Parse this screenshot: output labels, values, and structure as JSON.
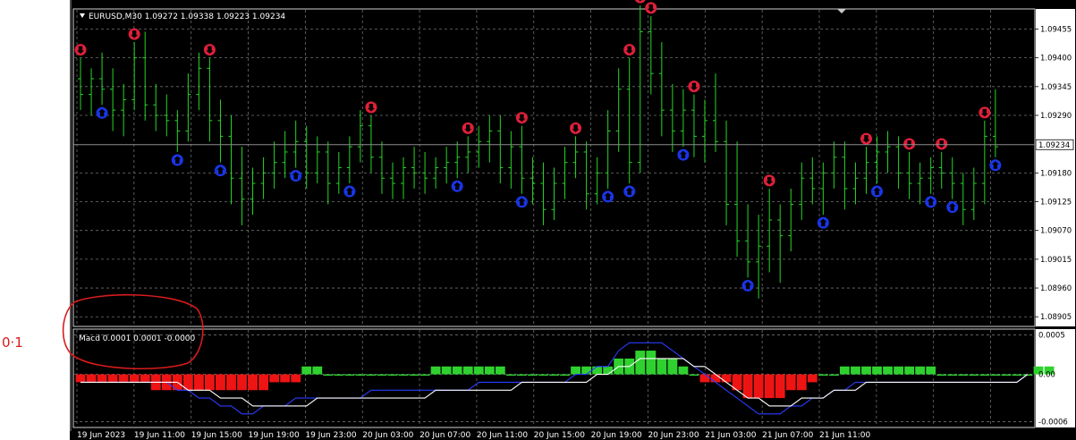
{
  "symbol_header": "EURUSD,M30  1.09272 1.09338 1.09223 1.09234",
  "current_price": "1.09234",
  "annotation_text": "0·1",
  "macd_label": "Macd 0.0001 0.0001 -0.0000",
  "colors": {
    "background": "#000000",
    "grid": "#6f6f6f",
    "bars": "#26d626",
    "sell_arrow": "#e0203a",
    "buy_arrow": "#1a35e8",
    "histogram_up": "#2fd12f",
    "histogram_down": "#ee1414",
    "macd_line": "#ffffff",
    "signal_line": "#2a3cff",
    "annotation": "#d81b1b"
  },
  "icons": {
    "sell": "down-arrow-circle-icon",
    "buy": "up-arrow-circle-icon",
    "menu": "triangle-down-icon"
  },
  "chart_data": [
    {
      "type": "ohlc-bars",
      "title": "EURUSD,M30",
      "y_ticks": [
        "1.09455",
        "1.09400",
        "1.09345",
        "1.09290",
        "1.09180",
        "1.09125",
        "1.09070",
        "1.09015",
        "1.08960",
        "1.08905"
      ],
      "ylim": [
        1.0889,
        1.0949
      ],
      "x_ticks": [
        "19 Jun 2023",
        "19 Jun 11:00",
        "19 Jun 15:00",
        "19 Jun 19:00",
        "19 Jun 23:00",
        "20 Jun 03:00",
        "20 Jun 07:00",
        "20 Jun 11:00",
        "20 Jun 15:00",
        "20 Jun 19:00",
        "20 Jun 23:00",
        "21 Jun 03:00",
        "21 Jun 07:00",
        "21 Jun 11:00"
      ],
      "last": {
        "open": 1.09272,
        "high": 1.09338,
        "low": 1.09223,
        "close": 1.09234
      },
      "bars": [
        [
          1.0936,
          1.094,
          1.093,
          1.0933
        ],
        [
          1.0933,
          1.0938,
          1.0929,
          1.0936
        ],
        [
          1.0936,
          1.0941,
          1.0931,
          1.0934
        ],
        [
          1.0934,
          1.0938,
          1.0926,
          1.093
        ],
        [
          1.093,
          1.0935,
          1.0925,
          1.0932
        ],
        [
          1.0932,
          1.0943,
          1.093,
          1.094
        ],
        [
          1.094,
          1.0945,
          1.0928,
          1.0931
        ],
        [
          1.0931,
          1.0935,
          1.0926,
          1.0929
        ],
        [
          1.0929,
          1.0933,
          1.0925,
          1.0928
        ],
        [
          1.0928,
          1.093,
          1.0922,
          1.0926
        ],
        [
          1.0926,
          1.0937,
          1.0924,
          1.0933
        ],
        [
          1.0933,
          1.0941,
          1.093,
          1.0938
        ],
        [
          1.0938,
          1.094,
          1.0924,
          1.0928
        ],
        [
          1.0928,
          1.0932,
          1.092,
          1.0925
        ],
        [
          1.0925,
          1.0929,
          1.0912,
          1.0917
        ],
        [
          1.0917,
          1.0923,
          1.0908,
          1.0913
        ],
        [
          1.0913,
          1.0919,
          1.091,
          1.0916
        ],
        [
          1.0916,
          1.0921,
          1.0913,
          1.0918
        ],
        [
          1.0918,
          1.0924,
          1.0915,
          1.092
        ],
        [
          1.092,
          1.0926,
          1.0917,
          1.0922
        ],
        [
          1.0922,
          1.0928,
          1.0919,
          1.0924
        ],
        [
          1.0924,
          1.0927,
          1.0915,
          1.0918
        ],
        [
          1.0918,
          1.0925,
          1.0916,
          1.0922
        ],
        [
          1.0922,
          1.0924,
          1.0912,
          1.0916
        ],
        [
          1.0916,
          1.0922,
          1.0914,
          1.0919
        ],
        [
          1.0919,
          1.0925,
          1.0916,
          1.0923
        ],
        [
          1.0923,
          1.093,
          1.092,
          1.0927
        ],
        [
          1.0927,
          1.0929,
          1.0918,
          1.0921
        ],
        [
          1.0921,
          1.0924,
          1.0914,
          1.0917
        ],
        [
          1.0917,
          1.092,
          1.0913,
          1.0916
        ],
        [
          1.0916,
          1.0921,
          1.0913,
          1.0919
        ],
        [
          1.0919,
          1.0923,
          1.0915,
          1.0918
        ],
        [
          1.0918,
          1.0922,
          1.0914,
          1.0917
        ],
        [
          1.0917,
          1.0921,
          1.0915,
          1.0919
        ],
        [
          1.0919,
          1.0923,
          1.0916,
          1.092
        ],
        [
          1.092,
          1.0924,
          1.0917,
          1.0921
        ],
        [
          1.0921,
          1.0925,
          1.0918,
          1.0922
        ],
        [
          1.0922,
          1.0927,
          1.0919,
          1.0924
        ],
        [
          1.0924,
          1.0929,
          1.092,
          1.0926
        ],
        [
          1.0926,
          1.0929,
          1.0916,
          1.0919
        ],
        [
          1.0919,
          1.0926,
          1.0915,
          1.0923
        ],
        [
          1.0923,
          1.0927,
          1.0914,
          1.0917
        ],
        [
          1.0917,
          1.0921,
          1.0912,
          1.0916
        ],
        [
          1.0916,
          1.092,
          1.0908,
          1.0911
        ],
        [
          1.0911,
          1.0919,
          1.0909,
          1.0916
        ],
        [
          1.0916,
          1.0923,
          1.0913,
          1.092
        ],
        [
          1.092,
          1.0925,
          1.0917,
          1.0922
        ],
        [
          1.0922,
          1.0924,
          1.0911,
          1.0914
        ],
        [
          1.0914,
          1.0921,
          1.0912,
          1.0918
        ],
        [
          1.0918,
          1.093,
          1.0915,
          1.0926
        ],
        [
          1.0926,
          1.0938,
          1.0922,
          1.0934
        ],
        [
          1.0934,
          1.094,
          1.0916,
          1.092
        ],
        [
          1.092,
          1.095,
          1.0918,
          1.0945
        ],
        [
          1.0945,
          1.0948,
          1.0933,
          1.0937
        ],
        [
          1.0937,
          1.0943,
          1.0925,
          1.093
        ],
        [
          1.093,
          1.0935,
          1.0922,
          1.0926
        ],
        [
          1.0926,
          1.0934,
          1.0923,
          1.093
        ],
        [
          1.093,
          1.0933,
          1.0921,
          1.0925
        ],
        [
          1.0925,
          1.0932,
          1.092,
          1.0928
        ],
        [
          1.0928,
          1.0937,
          1.0922,
          1.0924
        ],
        [
          1.0924,
          1.0928,
          1.0908,
          1.0912
        ],
        [
          1.0912,
          1.0924,
          1.0902,
          1.0905
        ],
        [
          1.0905,
          1.0912,
          1.0898,
          1.0901
        ],
        [
          1.0901,
          1.091,
          1.0894,
          1.0904
        ],
        [
          1.0904,
          1.0915,
          1.0899,
          1.0909
        ],
        [
          1.0909,
          1.0912,
          1.0897,
          1.0906
        ],
        [
          1.0906,
          1.0915,
          1.0903,
          1.0912
        ],
        [
          1.0912,
          1.092,
          1.0909,
          1.0917
        ],
        [
          1.0917,
          1.0921,
          1.0912,
          1.0915
        ],
        [
          1.0915,
          1.092,
          1.091,
          1.0918
        ],
        [
          1.0918,
          1.0924,
          1.0915,
          1.0921
        ],
        [
          1.0921,
          1.0924,
          1.0911,
          1.0915
        ],
        [
          1.0915,
          1.092,
          1.0912,
          1.0917
        ],
        [
          1.0917,
          1.0923,
          1.0914,
          1.092
        ],
        [
          1.092,
          1.0925,
          1.0916,
          1.0922
        ],
        [
          1.0922,
          1.0926,
          1.0918,
          1.0923
        ],
        [
          1.0923,
          1.0925,
          1.0915,
          1.0918
        ],
        [
          1.0918,
          1.0922,
          1.0913,
          1.0916
        ],
        [
          1.0916,
          1.092,
          1.0912,
          1.0917
        ],
        [
          1.0917,
          1.0921,
          1.0914,
          1.0919
        ],
        [
          1.0919,
          1.0922,
          1.0915,
          1.0918
        ],
        [
          1.0918,
          1.0921,
          1.0913,
          1.0916
        ],
        [
          1.0916,
          1.0918,
          1.0908,
          1.0911
        ],
        [
          1.0911,
          1.0919,
          1.0909,
          1.0916
        ],
        [
          1.0916,
          1.0928,
          1.0912,
          1.0925
        ],
        [
          1.0925,
          1.0934,
          1.0921,
          1.0923
        ]
      ],
      "sell_signal_bars": [
        0,
        5,
        12,
        27,
        36,
        41,
        46,
        51,
        52,
        53,
        57,
        64,
        73,
        77,
        80,
        84,
        88
      ],
      "buy_signal_bars": [
        2,
        9,
        13,
        20,
        25,
        35,
        41,
        49,
        51,
        56,
        62,
        69,
        74,
        79,
        81,
        85,
        86
      ]
    },
    {
      "type": "macd",
      "title": "Macd 0.0001 0.0001 -0.0000",
      "y_ticks": [
        "0.0005",
        "0.00",
        "-0.0006"
      ],
      "ylim": [
        -0.00065,
        0.00055
      ],
      "histogram": [
        -0.0001,
        -0.0001,
        -0.0001,
        -0.0001,
        -0.0001,
        -0.0001,
        -0.0001,
        -0.0002,
        -0.0002,
        -0.0002,
        -0.0002,
        -0.0002,
        -0.0002,
        -0.0002,
        -0.0002,
        -0.0002,
        -0.0002,
        -0.0002,
        -0.0001,
        -0.0001,
        -0.0001,
        0.0001,
        0.0001,
        0.0,
        0.0,
        0.0,
        0.0,
        0.0,
        0.0,
        0.0,
        0.0,
        0.0,
        0.0,
        0.0001,
        0.0001,
        0.0001,
        0.0001,
        0.0001,
        0.0001,
        0.0001,
        0.0,
        0.0,
        0.0,
        0.0,
        0.0,
        0.0,
        0.0001,
        0.0001,
        0.0001,
        0.0001,
        0.0002,
        0.0002,
        0.0003,
        0.0003,
        0.0002,
        0.0002,
        0.0001,
        0.0,
        -0.0001,
        -0.0001,
        -0.0001,
        -0.0002,
        -0.0003,
        -0.0003,
        -0.0003,
        -0.0003,
        -0.0002,
        -0.0002,
        -0.0001,
        0.0,
        0.0,
        0.0001,
        0.0001,
        0.0001,
        0.0001,
        0.0001,
        0.0001,
        0.0001,
        0.0001,
        0.0001,
        0.0,
        0.0,
        0.0,
        0.0,
        0.0,
        0.0,
        0.0,
        0.0,
        0.0,
        0.0001,
        0.0001
      ],
      "macd_line": [
        -0.0001,
        -0.0001,
        -0.0001,
        -0.0001,
        -0.0001,
        -0.0001,
        -0.0001,
        -0.0001,
        -0.0001,
        -0.0001,
        -0.0002,
        -0.0002,
        -0.0002,
        -0.0003,
        -0.0003,
        -0.0003,
        -0.0004,
        -0.0004,
        -0.0004,
        -0.0004,
        -0.0004,
        -0.0004,
        -0.0003,
        -0.0003,
        -0.0003,
        -0.0003,
        -0.0003,
        -0.0003,
        -0.0003,
        -0.0003,
        -0.0003,
        -0.0003,
        -0.0003,
        -0.0002,
        -0.0002,
        -0.0002,
        -0.0002,
        -0.0002,
        -0.0002,
        -0.0002,
        -0.0002,
        -0.0001,
        -0.0001,
        -0.0001,
        -0.0001,
        -0.0001,
        -0.0001,
        -0.0001,
        0.0,
        0.0,
        0.0001,
        0.0001,
        0.0002,
        0.0002,
        0.0002,
        0.0002,
        0.0002,
        0.0001,
        0.0001,
        0.0,
        -0.0001,
        -0.0002,
        -0.0003,
        -0.0003,
        -0.0004,
        -0.0004,
        -0.0004,
        -0.0003,
        -0.0003,
        -0.0003,
        -0.0002,
        -0.0002,
        -0.0002,
        -0.0001,
        -0.0001,
        -0.0001,
        -0.0001,
        -0.0001,
        -0.0001,
        -0.0001,
        -0.0001,
        -0.0001,
        -0.0001,
        -0.0001,
        -0.0001,
        -0.0001,
        -0.0001,
        -0.0001,
        0.0
      ],
      "signal_line": [
        -0.0001,
        -0.0001,
        -0.0001,
        -0.0001,
        -0.0001,
        -0.0001,
        -0.0001,
        -0.0001,
        -0.0001,
        -0.0002,
        -0.0002,
        -0.0003,
        -0.0003,
        -0.0004,
        -0.0004,
        -0.0005,
        -0.0005,
        -0.0004,
        -0.0004,
        -0.0004,
        -0.0003,
        -0.0003,
        -0.0003,
        -0.0003,
        -0.0003,
        -0.0003,
        -0.0003,
        -0.0002,
        -0.0002,
        -0.0002,
        -0.0002,
        -0.0002,
        -0.0002,
        -0.0002,
        -0.0002,
        -0.0002,
        -0.0002,
        -0.0001,
        -0.0001,
        -0.0001,
        -0.0001,
        -0.0001,
        -0.0001,
        -0.0001,
        -0.0001,
        -0.0001,
        0.0,
        0.0,
        0.0001,
        0.0001,
        0.0003,
        0.0004,
        0.0004,
        0.0004,
        0.0004,
        0.0003,
        0.0002,
        0.0001,
        0.0,
        -0.0001,
        -0.0002,
        -0.0003,
        -0.0004,
        -0.0005,
        -0.0005,
        -0.0005,
        -0.0004,
        -0.0004,
        -0.0003,
        -0.0003,
        -0.0002,
        -0.0002,
        -0.0001,
        -0.0001,
        -0.0001,
        -0.0001,
        -0.0001,
        -0.0001,
        -0.0001,
        -0.0001,
        -0.0001,
        -0.0001,
        -0.0001,
        -0.0001,
        -0.0001,
        -0.0001,
        -0.0001,
        -0.0001,
        0.0
      ]
    }
  ]
}
